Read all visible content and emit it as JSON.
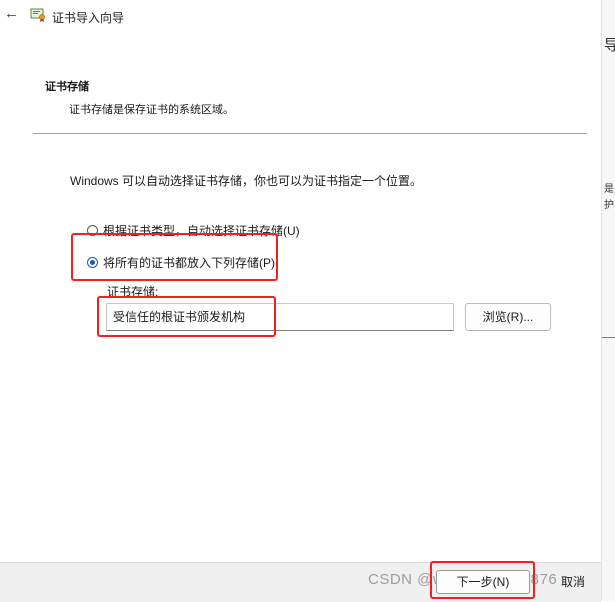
{
  "titlebar": {
    "title": "证书导入向导"
  },
  "header": {
    "heading": "证书存储",
    "description": "证书存储是保存证书的系统区域。"
  },
  "main": {
    "intro": "Windows 可以自动选择证书存储，你也可以为证书指定一个位置。",
    "options": [
      {
        "label": "根据证书类型，自动选择证书存储(U)",
        "checked": false
      },
      {
        "label": "将所有的证书都放入下列存储(P)",
        "checked": true
      }
    ],
    "store_label": "证书存储:",
    "store_value": "受信任的根证书颁发机构",
    "browse_label": "浏览(R)..."
  },
  "footer": {
    "next_label": "下一步(N)",
    "cancel_label": "取消"
  },
  "watermark": "CSDN @weixin_43992876",
  "edge": {
    "chars": [
      "导",
      "是",
      "护"
    ]
  },
  "colors": {
    "accent": "#1a56c9",
    "annotation": "#ee2222",
    "divider": "#a0a0a0"
  }
}
